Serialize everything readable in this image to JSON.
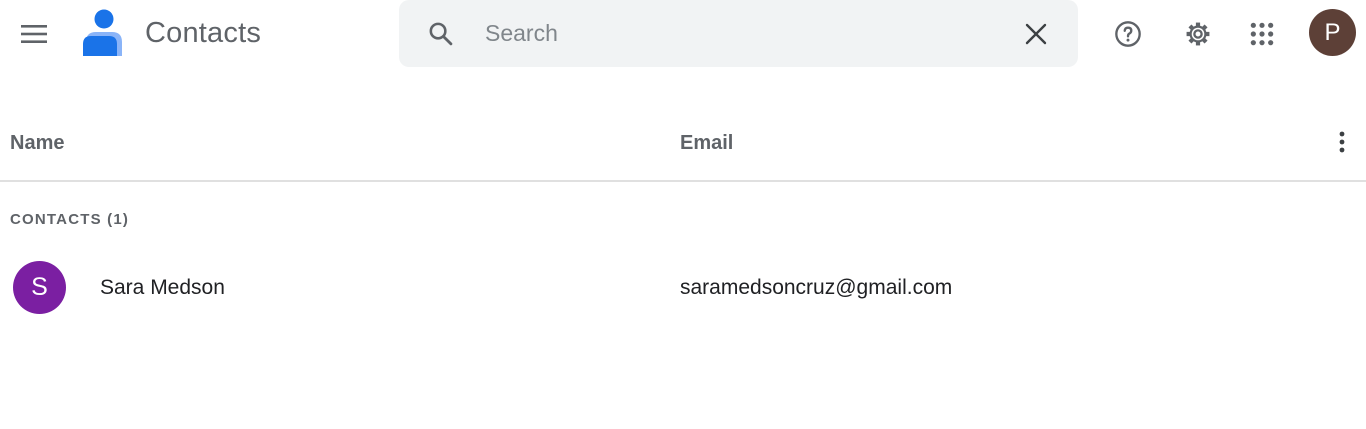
{
  "header": {
    "app_title": "Contacts",
    "menu_icon": "hamburger-menu-icon",
    "logo_icon": "contacts-logo-icon",
    "search": {
      "placeholder": "Search",
      "value": "",
      "search_icon": "search-icon",
      "clear_icon": "close-icon"
    },
    "help_icon": "help-icon",
    "settings_icon": "gear-icon",
    "apps_icon": "apps-grid-icon",
    "account_avatar": {
      "letter": "P",
      "color": "#5d4037"
    }
  },
  "table": {
    "columns": [
      "Name",
      "Email"
    ],
    "more_icon": "more-vert-icon",
    "section_label": "CONTACTS (1)",
    "rows": [
      {
        "initial": "S",
        "avatar_color": "#7b1fa2",
        "name": "Sara Medson",
        "email": "saramedsoncruz@gmail.com"
      }
    ]
  },
  "colors": {
    "accent": "#1a73e8",
    "search_bg": "#f1f3f4",
    "muted_text": "#5f6368"
  }
}
